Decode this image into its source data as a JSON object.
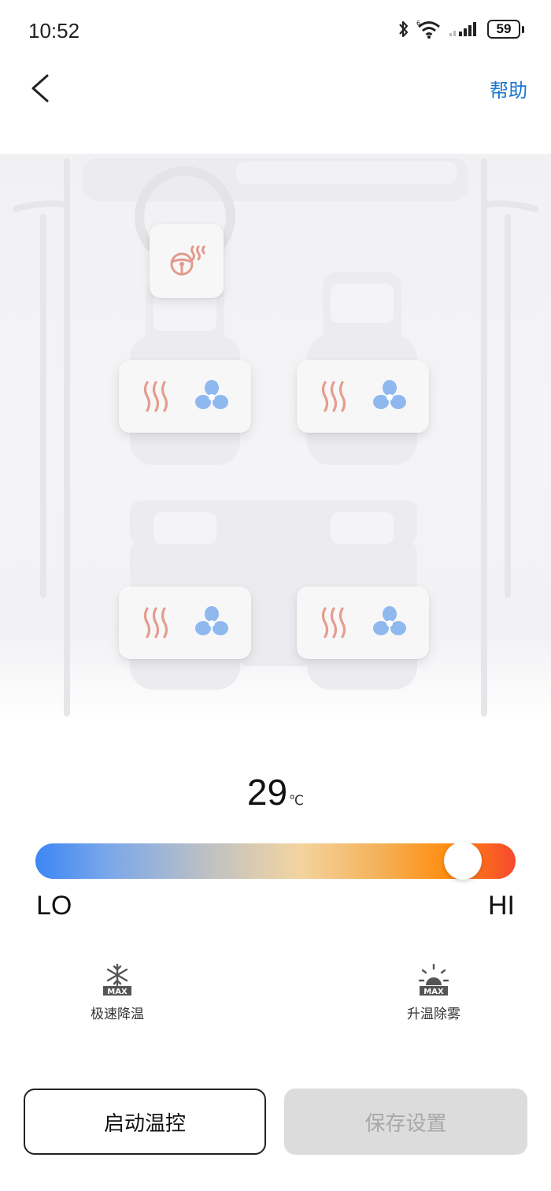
{
  "status_bar": {
    "time": "10:52",
    "battery": "59"
  },
  "header": {
    "help_label": "帮助"
  },
  "climate": {
    "temperature": "29",
    "unit": "℃",
    "slider_level": 0.92,
    "lo_label": "LO",
    "hi_label": "HI"
  },
  "modes": {
    "rapid_cool_label": "极速降温",
    "rapid_cool_badge": "MAX",
    "defog_label": "升温除雾",
    "defog_badge": "MAX"
  },
  "actions": {
    "start_label": "启动温控",
    "save_label": "保存设置"
  },
  "colors": {
    "accent": "#1976d2",
    "heat": "#e59c8f",
    "fan": "#8fb8ef",
    "disabled_button": "#dcdcdc"
  }
}
